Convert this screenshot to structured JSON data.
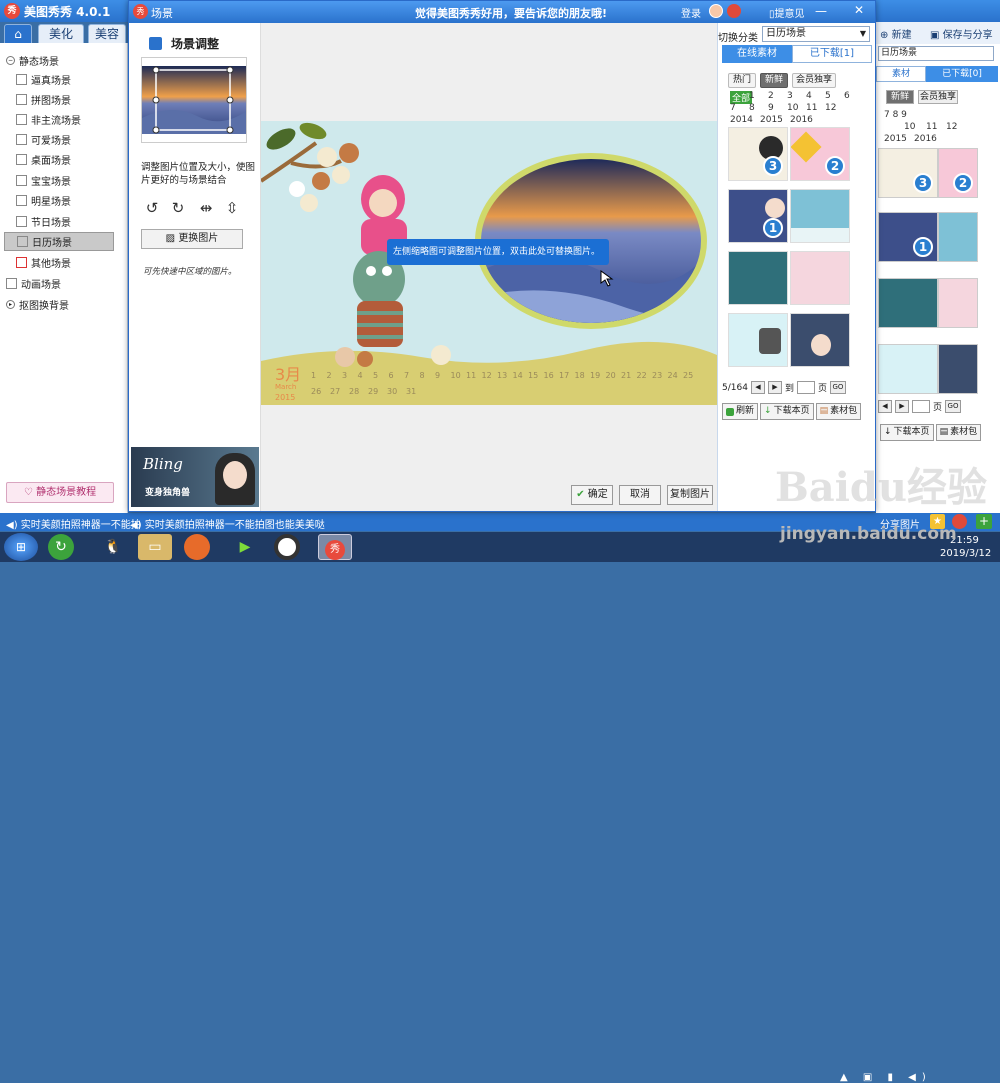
{
  "main_app": {
    "title": "美图秀秀 4.0.1",
    "logo_glyph": "秀",
    "tabs": [
      "美化",
      "美容"
    ],
    "tree": {
      "static_group": "静态场景",
      "items": [
        "逼真场景",
        "拼图场景",
        "非主流场景",
        "可爱场景",
        "桌面场景",
        "宝宝场景",
        "明星场景",
        "节日场景",
        "日历场景",
        "其他场景"
      ],
      "selected": "日历场景",
      "animated_group": "动画场景",
      "cutout_group": "抠图换背景"
    },
    "tutorial_button": "静态场景教程",
    "right_toolbar": {
      "new": "新建",
      "save_share": "保存与分享"
    },
    "right_select": "日历场景",
    "right_tabs": [
      "素材",
      "已下载[0]"
    ],
    "right_filters": [
      "新鲜",
      "会员独享"
    ],
    "right_numbers": [
      "10",
      "11",
      "12",
      "2015",
      "2016"
    ],
    "right_pager": "页",
    "right_download": "下载本页",
    "right_pack": "素材包",
    "share_label": "分享图片"
  },
  "status_bar": {
    "text_a": "实时美颜拍照神器一不能拍",
    "text_b": "实时美颜拍照神器一不能拍图也能美美哒"
  },
  "taskbar": {
    "time": "21:59",
    "date": "2019/3/12"
  },
  "dialog": {
    "title": "场景",
    "logo_glyph": "秀",
    "slogan": "觉得美图秀秀好用，要告诉您的朋友哦!",
    "login": "登录",
    "hint": "提意见",
    "adjust": {
      "title": "场景调整",
      "description": "调整图片位置及大小，使图片更好的与场景结合",
      "replace_button": "更换图片",
      "handwritten": "可先快速中区域的图片。"
    },
    "banner": {
      "title": "Bling",
      "subtitle": "变身独角兽"
    },
    "canvas": {
      "tooltip": "左侧缩略图可调整图片位置，双击此处可替换图片。",
      "month_label": "3月",
      "month_en": "March",
      "year": "2015",
      "dates_row1": [
        "1",
        "2",
        "3",
        "4",
        "5",
        "6",
        "7",
        "8",
        "9",
        "10",
        "11",
        "12",
        "13",
        "14",
        "15",
        "16",
        "17",
        "18",
        "19",
        "20",
        "21",
        "22",
        "23",
        "24",
        "25"
      ],
      "dates_row2": [
        "26",
        "27",
        "28",
        "29",
        "30",
        "31"
      ]
    },
    "buttons": {
      "confirm": "确定",
      "cancel": "取消",
      "copy": "复制图片"
    },
    "material": {
      "category_label": "切换分类",
      "category_value": "日历场景",
      "tabs": {
        "online": "在线素材",
        "downloaded": "已下载[1]"
      },
      "filters": [
        "热门",
        "新鲜",
        "会员独享"
      ],
      "active_filter": "新鲜",
      "numbers_row1": [
        "全部",
        "1",
        "2",
        "3",
        "4",
        "5",
        "6"
      ],
      "numbers_row2": [
        "7",
        "8",
        "9",
        "10",
        "11",
        "12"
      ],
      "years": [
        "2014",
        "2015",
        "2016"
      ],
      "thumb_badges": [
        "3",
        "2",
        "1"
      ],
      "pager": {
        "current": "5/164",
        "to": "到",
        "page": "页",
        "go": "GO"
      },
      "actions": {
        "refresh": "刷新",
        "download_page": "下载本页",
        "pack": "素材包"
      }
    }
  },
  "watermark": {
    "text": "jingyan.baidu.com",
    "logo": "Baidu经验"
  }
}
